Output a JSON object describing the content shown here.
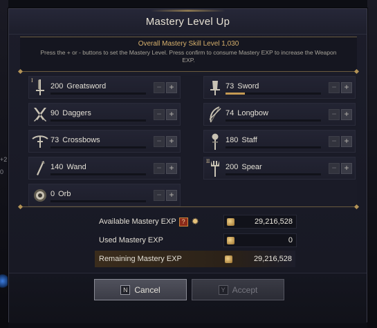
{
  "window": {
    "title": "Mastery Level Up"
  },
  "header": {
    "headline": "Overall Mastery Skill Level 1,030",
    "description": "Press the + or - buttons to set the Mastery Level. Press confirm to consume Mastery EXP to increase the Weapon EXP."
  },
  "skills": [
    {
      "level": "200",
      "name": "Greatsword",
      "icon": "greatsword-icon",
      "rank": "I",
      "progress": 0
    },
    {
      "level": "73",
      "name": "Sword",
      "icon": "sword-icon",
      "progress": 0.2
    },
    {
      "level": "90",
      "name": "Daggers",
      "icon": "daggers-icon",
      "progress": 0
    },
    {
      "level": "74",
      "name": "Longbow",
      "icon": "longbow-icon",
      "progress": 0
    },
    {
      "level": "73",
      "name": "Crossbows",
      "icon": "crossbow-icon",
      "progress": 0
    },
    {
      "level": "180",
      "name": "Staff",
      "icon": "staff-icon",
      "progress": 0
    },
    {
      "level": "140",
      "name": "Wand",
      "icon": "wand-icon",
      "progress": 0
    },
    {
      "level": "200",
      "name": "Spear",
      "icon": "spear-icon",
      "rank": "II",
      "progress": 0
    },
    {
      "level": "0",
      "name": "Orb",
      "icon": "orb-icon",
      "progress": 0
    }
  ],
  "buttons": {
    "minus": "−",
    "plus": "+"
  },
  "exp": {
    "available_label": "Available Mastery EXP",
    "available_value": "29,216,528",
    "help_label": "?",
    "used_label": "Used Mastery EXP",
    "used_value": "0",
    "remaining_label": "Remaining Mastery EXP",
    "remaining_value": "29,216,528"
  },
  "footer": {
    "cancel_key": "N",
    "cancel_label": "Cancel",
    "accept_key": "Y",
    "accept_label": "Accept"
  },
  "background": {
    "left_text_1": "+2",
    "left_text_2": "0"
  }
}
